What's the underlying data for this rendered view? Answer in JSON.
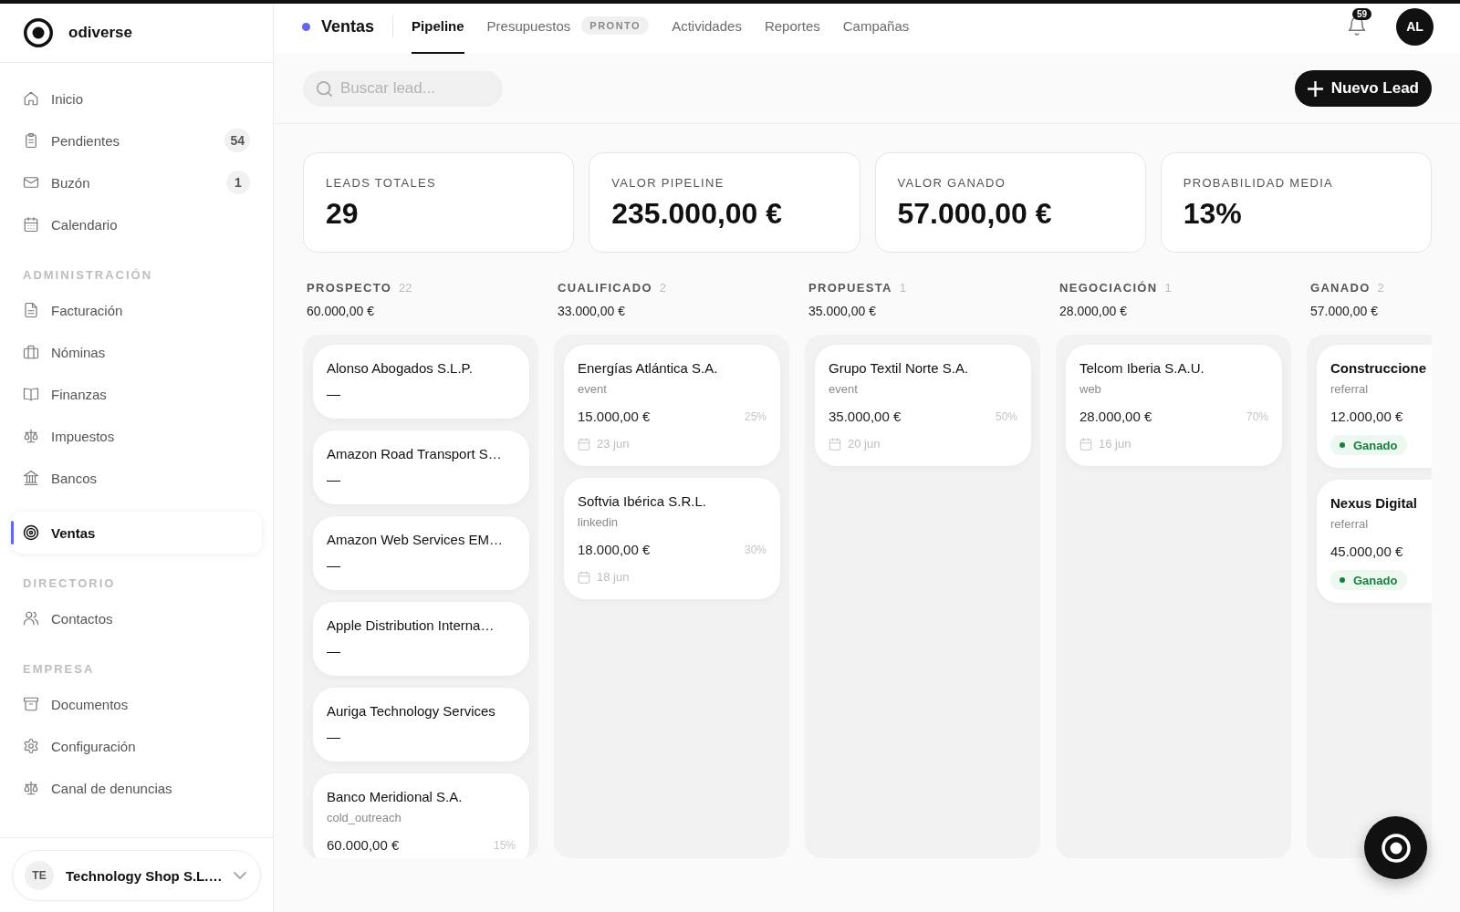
{
  "sidebar": {
    "brand": "odiverse",
    "groups": [
      {
        "items": [
          {
            "label": "Inicio",
            "selected": false
          },
          {
            "label": "Pendientes",
            "selected": false,
            "count": "54"
          },
          {
            "label": "Buzón",
            "selected": false,
            "count": "1"
          },
          {
            "label": "Calendario",
            "selected": false
          }
        ]
      },
      {
        "heading": "ADMINISTRACIÓN",
        "items": [
          {
            "label": "Facturación",
            "selected": false
          },
          {
            "label": "Nóminas",
            "selected": false
          },
          {
            "label": "Finanzas",
            "selected": false
          },
          {
            "label": "Impuestos",
            "selected": false
          },
          {
            "label": "Bancos",
            "selected": false
          }
        ]
      },
      {
        "items": [
          {
            "label": "Ventas",
            "selected": true
          }
        ]
      },
      {
        "heading": "DIRECTORIO",
        "items": [
          {
            "label": "Contactos",
            "selected": false
          }
        ]
      },
      {
        "heading": "EMPRESA",
        "items": [
          {
            "label": "Documentos",
            "selected": false
          },
          {
            "label": "Configuración",
            "selected": false
          },
          {
            "label": "Canal de denuncias",
            "selected": false
          }
        ]
      }
    ],
    "company": {
      "initials": "TE",
      "name": "Technology Shop S.L.…"
    }
  },
  "header": {
    "section": "Ventas",
    "tabs": [
      {
        "label": "Pipeline",
        "selected": true
      },
      {
        "label": "Presupuestos",
        "selected": false,
        "badge": "PRONTO"
      },
      {
        "label": "Actividades",
        "selected": false
      },
      {
        "label": "Reportes",
        "selected": false
      },
      {
        "label": "Campañas",
        "selected": false
      }
    ],
    "notifications": "59",
    "user_initials": "AL"
  },
  "toolbar": {
    "search": {
      "placeholder": "Buscar lead..."
    },
    "new_button": "Nuevo Lead"
  },
  "stats": [
    {
      "label": "LEADS TOTALES",
      "value": "29"
    },
    {
      "label": "VALOR PIPELINE",
      "value": "235.000,00 €"
    },
    {
      "label": "VALOR GANADO",
      "value": "57.000,00 €"
    },
    {
      "label": "PROBABILIDAD MEDIA",
      "value": "13%"
    }
  ],
  "board": {
    "columns": [
      {
        "title": "PROSPECTO",
        "count": "22",
        "total": "60.000,00 €",
        "cards": [
          {
            "kind": "empty",
            "name": "Alonso Abogados S.L.P.",
            "value": "—"
          },
          {
            "kind": "empty",
            "name": "Amazon Road Transport S…",
            "value": "—"
          },
          {
            "kind": "empty",
            "name": "Amazon Web Services EM…",
            "value": "—"
          },
          {
            "kind": "empty",
            "name": "Apple Distribution Interna…",
            "value": "—"
          },
          {
            "kind": "empty",
            "name": "Auriga Technology Services",
            "value": "—"
          },
          {
            "kind": "lead",
            "name": "Banco Meridional S.A.",
            "source": "cold_outreach",
            "amount": "60.000,00 €",
            "probability": "15%"
          }
        ]
      },
      {
        "title": "CUALIFICADO",
        "count": "2",
        "total": "33.000,00 €",
        "cards": [
          {
            "kind": "lead",
            "name": "Energías Atlántica S.A.",
            "source": "event",
            "amount": "15.000,00 €",
            "probability": "25%",
            "date": "23 jun"
          },
          {
            "kind": "lead",
            "name": "Softvia Ibérica S.R.L.",
            "source": "linkedin",
            "amount": "18.000,00 €",
            "probability": "30%",
            "date": "18 jun"
          }
        ]
      },
      {
        "title": "PROPUESTA",
        "count": "1",
        "total": "35.000,00 €",
        "cards": [
          {
            "kind": "lead",
            "name": "Grupo Textil Norte S.A.",
            "source": "event",
            "amount": "35.000,00 €",
            "probability": "50%",
            "date": "20 jun"
          }
        ]
      },
      {
        "title": "NEGOCIACIÓN",
        "count": "1",
        "total": "28.000,00 €",
        "cards": [
          {
            "kind": "lead",
            "name": "Telcom Iberia S.A.U.",
            "source": "web",
            "amount": "28.000,00 €",
            "probability": "70%",
            "date": "16 jun"
          }
        ]
      },
      {
        "title": "GANADO",
        "count": "2",
        "total": "57.000,00 €",
        "cards": [
          {
            "kind": "won",
            "name": "Construccione",
            "source": "referral",
            "amount": "12.000,00 €",
            "status": "Ganado"
          },
          {
            "kind": "won",
            "name": "Nexus Digital",
            "source": "referral",
            "amount": "45.000,00 €",
            "status": "Ganado"
          }
        ]
      }
    ]
  }
}
